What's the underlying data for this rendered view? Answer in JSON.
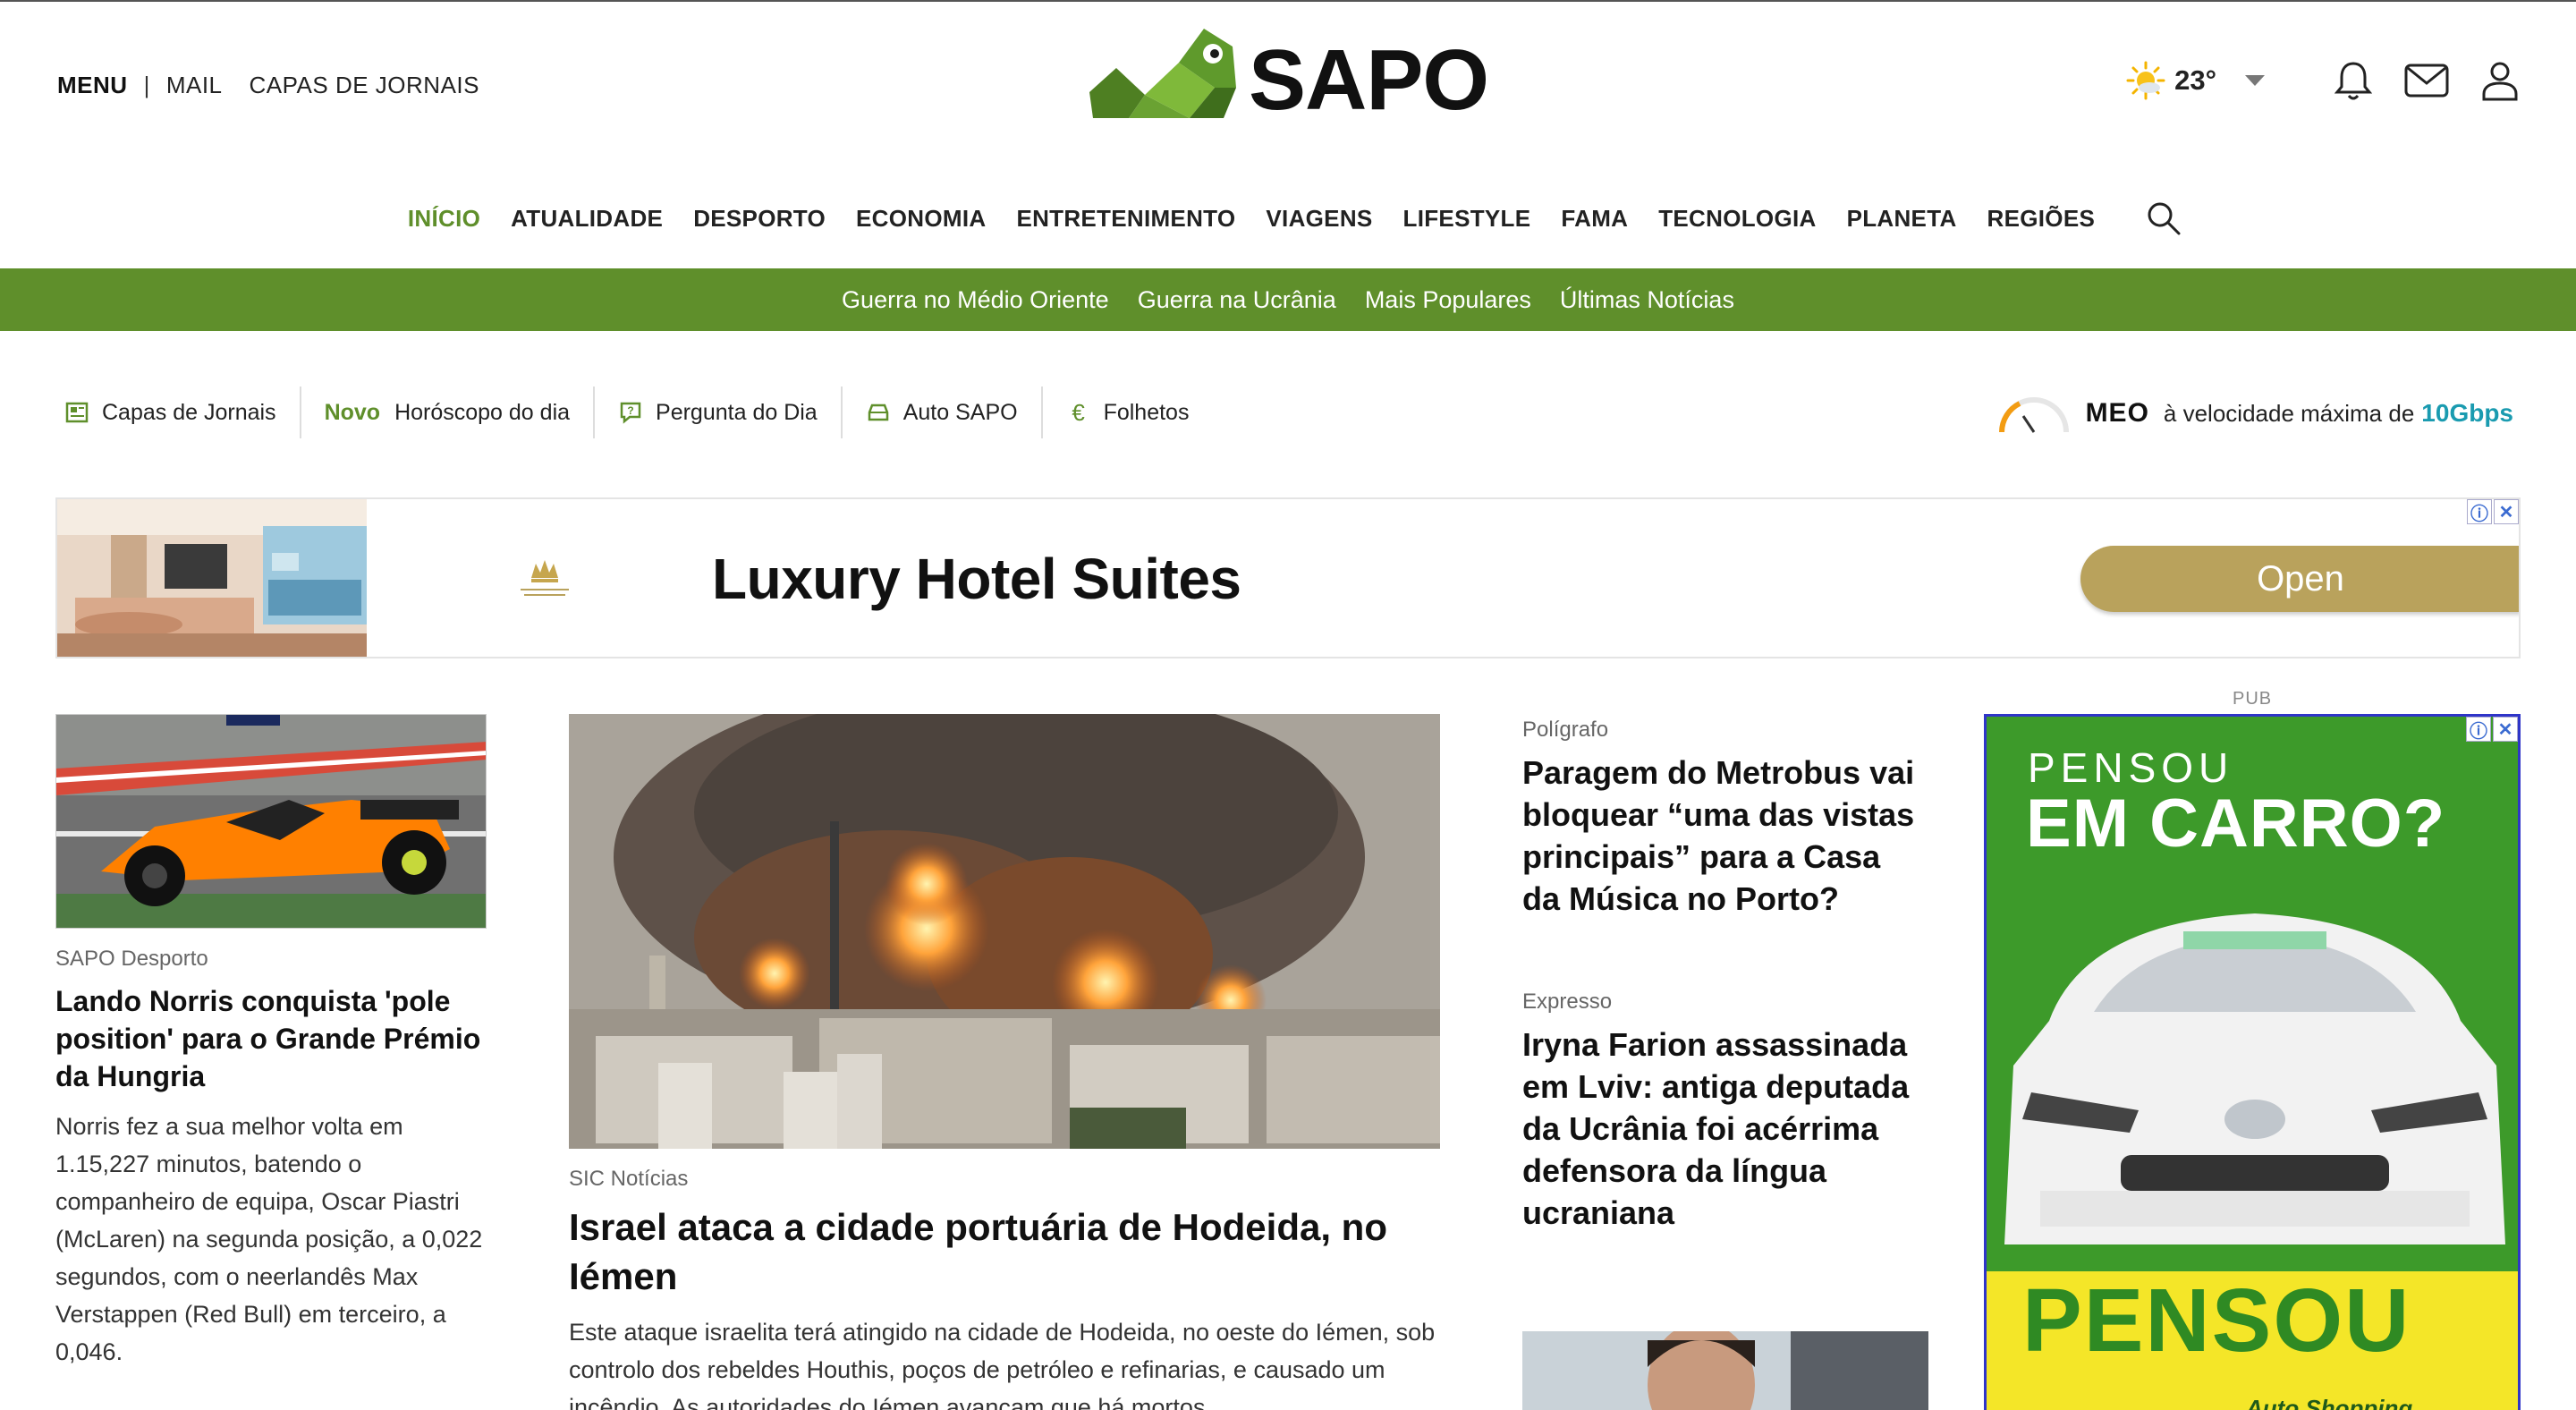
{
  "header": {
    "menu_label": "MENU",
    "separator": "|",
    "mail_label": "MAIL",
    "capas_label": "CAPAS DE JORNAIS",
    "logo_text": "SAPO",
    "weather_temp": "23°"
  },
  "nav": {
    "items": [
      "INÍCIO",
      "ATUALIDADE",
      "DESPORTO",
      "ECONOMIA",
      "ENTRETENIMENTO",
      "VIAGENS",
      "LIFESTYLE",
      "FAMA",
      "TECNOLOGIA",
      "PLANETA",
      "REGIÕES"
    ],
    "active": "INÍCIO"
  },
  "greenbar": {
    "links": [
      "Guerra no Médio Oriente",
      "Guerra na Ucrânia",
      "Mais Populares",
      "Últimas Notícias"
    ]
  },
  "shortcuts": {
    "capas": "Capas de Jornais",
    "novo": "Novo",
    "horoscopo": "Horóscopo do dia",
    "pergunta": "Pergunta do Dia",
    "auto": "Auto SAPO",
    "folhetos": "Folhetos"
  },
  "meo": {
    "brand": "MEO",
    "text": "à velocidade máxima de",
    "speed": "10Gbps"
  },
  "banner_ad": {
    "headline": "Luxury Hotel Suites",
    "button": "Open"
  },
  "articles": {
    "left": {
      "source": "SAPO Desporto",
      "title": "Lando Norris conquista 'pole position' para o Grande Prémio da Hungria",
      "summary": "Norris fez a sua melhor volta em 1.15,227 minutos, batendo o companheiro de equipa, Oscar Piastri (McLaren) na segunda posição, a 0,022 segundos, com o neerlandês Max Verstappen (Red Bull) em terceiro, a 0,046."
    },
    "center": {
      "source": "SIC Notícias",
      "title": "Israel ataca a cidade portuária de Hodeida, no Iémen",
      "summary": "Este ataque israelita terá atingido na cidade de Hodeida, no oeste do Iémen, sob controlo dos rebeldes Houthis, poços de petróleo e refinarias, e causado um incêndio. As autoridades do Iémen avançam que há mortos"
    },
    "right1": {
      "source": "Polígrafo",
      "title": "Paragem do Metrobus vai bloquear “uma das vistas principais” para a Casa da Música no Porto?"
    },
    "right2": {
      "source": "Expresso",
      "title": "Iryna Farion assassinada em Lviv: antiga deputada da Ucrânia foi acérrima defensora da língua ucraniana"
    }
  },
  "side_ad": {
    "pub_label": "PUB",
    "line1": "PENSOU",
    "line2": "EM CARRO?",
    "line3": "PENSOU",
    "line4": "Auto Shopping"
  },
  "colors": {
    "brand_green": "#5f8f2b",
    "meo_speed": "#1a9bb0",
    "ad_gold": "#b9a25c"
  }
}
